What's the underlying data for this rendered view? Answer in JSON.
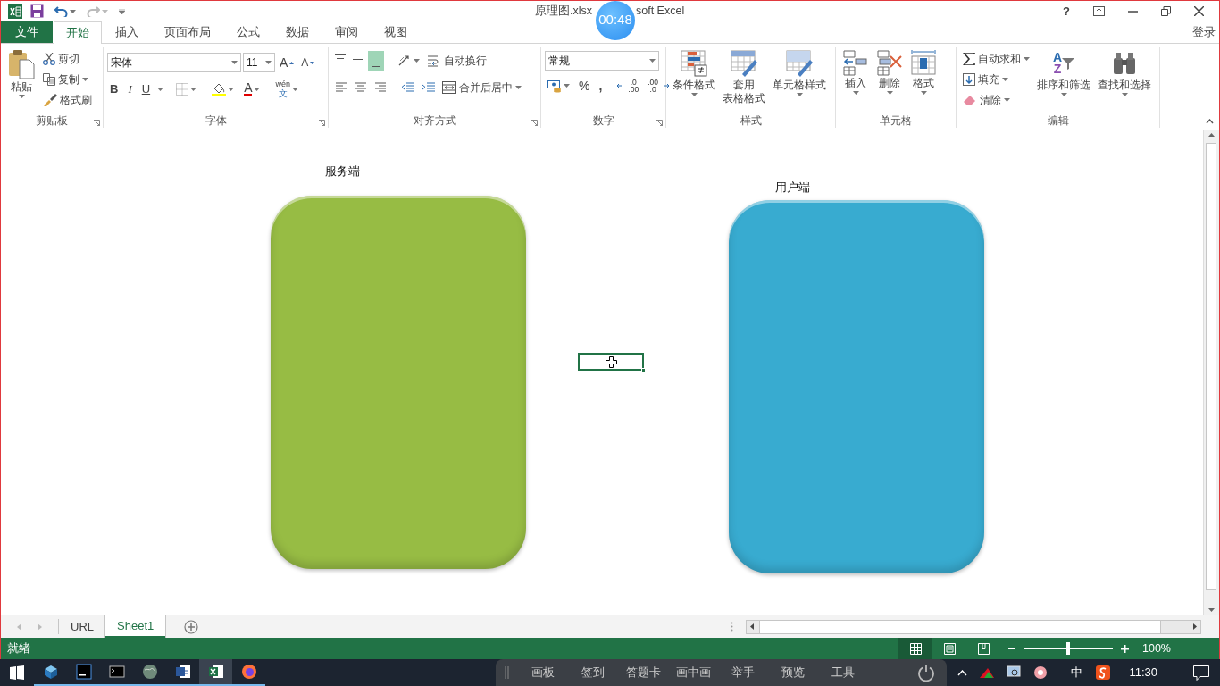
{
  "window": {
    "title_left": "原理图.xlsx",
    "title_right": "soft Excel",
    "timer": "00:48",
    "help": "?",
    "account": "登录"
  },
  "tabs": [
    {
      "label": "文件",
      "kind": "file",
      "selected": false
    },
    {
      "label": "开始",
      "kind": "tab",
      "selected": true
    },
    {
      "label": "插入",
      "kind": "tab",
      "selected": false
    },
    {
      "label": "页面布局",
      "kind": "tab",
      "selected": false
    },
    {
      "label": "公式",
      "kind": "tab",
      "selected": false
    },
    {
      "label": "数据",
      "kind": "tab",
      "selected": false
    },
    {
      "label": "审阅",
      "kind": "tab",
      "selected": false
    },
    {
      "label": "视图",
      "kind": "tab",
      "selected": false
    }
  ],
  "ribbon": {
    "clipboard": {
      "title": "剪贴板",
      "paste": "粘贴",
      "cut": "剪切",
      "copy": "复制",
      "painter": "格式刷"
    },
    "font": {
      "title": "字体",
      "name": "宋体",
      "size": "11",
      "grow": "A",
      "shrink": "A",
      "bold": "B",
      "italic": "I",
      "underline": "U",
      "font_color": "A",
      "phonetic_top": "wén",
      "phonetic_bottom": "文"
    },
    "alignment": {
      "title": "对齐方式",
      "vertical": [
        {
          "selected": false
        },
        {
          "selected": false
        },
        {
          "selected": true
        }
      ],
      "wrap": "自动换行",
      "merge": "合并后居中"
    },
    "number": {
      "title": "数字",
      "format": "常规",
      "percent": "%",
      "comma": ",",
      "increase_decimal": [
        ".0",
        ".00"
      ],
      "decrease_decimal": [
        ".00",
        ".0"
      ]
    },
    "styles": {
      "title": "样式",
      "conditional": "条件格式",
      "table_line1": "套用",
      "table_line2": "表格格式",
      "cell_styles": "单元格样式"
    },
    "cells": {
      "title": "单元格",
      "insert": "插入",
      "delete": "删除",
      "format": "格式"
    },
    "editing": {
      "title": "编辑",
      "autosum": "自动求和",
      "fill": "填充",
      "clear": "清除",
      "sort_glyphs": [
        "A",
        "Z"
      ],
      "sort": "排序和筛选",
      "find": "查找和选择"
    }
  },
  "canvas": {
    "shapes": [
      {
        "label": "服务端",
        "color": "#97bc44"
      },
      {
        "label": "用户端",
        "color": "#38abd0"
      }
    ]
  },
  "sheet_tabs": [
    {
      "label": "URL",
      "selected": false
    },
    {
      "label": "Sheet1",
      "selected": true
    }
  ],
  "status_bar": {
    "text": "就绪",
    "views": [
      {
        "selected": true
      },
      {
        "selected": false
      },
      {
        "selected": false
      }
    ],
    "zoom": {
      "level": 0.5,
      "reading": "100%"
    }
  },
  "taskbar": {
    "apps": [
      {
        "kind": "cube",
        "selected": false
      },
      {
        "kind": "ide",
        "selected": false
      },
      {
        "kind": "terminal",
        "selected": false
      },
      {
        "kind": "globe",
        "selected": false
      },
      {
        "kind": "word",
        "selected": false
      },
      {
        "kind": "excel",
        "selected": true
      },
      {
        "kind": "firefox",
        "selected": false
      }
    ],
    "class_tools": [
      "画板",
      "签到",
      "答题卡",
      "画中画",
      "举手",
      "预览",
      "工具"
    ],
    "ime": "中",
    "time": "11:30"
  }
}
